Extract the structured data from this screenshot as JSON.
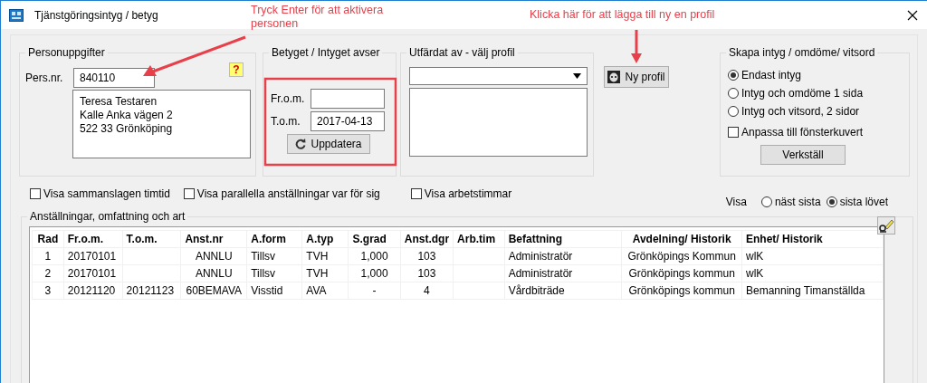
{
  "window": {
    "title": "Tjänstgöringsintyg / betyg"
  },
  "annotations": [
    {
      "text": "Tryck Enter för att aktivera personen"
    },
    {
      "text": "Klicka här för att lägga till ny en profil"
    }
  ],
  "person": {
    "title": "Personuppgifter",
    "pers_nr_label": "Pers.nr.",
    "pers_nr_value": "840110",
    "help_button": "?",
    "address_lines": [
      "Teresa Testaren",
      "Kalle Anka vägen 2",
      "522 33 Grönköping"
    ]
  },
  "period": {
    "title": "Betyget / Intyget avser",
    "from_label": "Fr.o.m.",
    "to_label": "T.o.m.",
    "to_value": "2017-04-13",
    "update_button": "Uppdatera"
  },
  "issued_by": {
    "title": "Utfärdat av - välj profil"
  },
  "new_profile_button": "Ny profil",
  "create": {
    "title": "Skapa intyg / omdöme/ vitsord",
    "options": [
      {
        "label": "Endast intyg",
        "selected": true
      },
      {
        "label": "Intyg och omdöme 1 sida",
        "selected": false
      },
      {
        "label": "Intyg och vitsord, 2 sidor",
        "selected": false
      }
    ],
    "fit_envelope": {
      "label": "Anpassa till fönsterkuvert",
      "checked": false
    },
    "apply_button": "Verkställ"
  },
  "checkboxes": [
    {
      "label": "Visa sammanslagen timtid",
      "checked": false
    },
    {
      "label": "Visa parallella anställningar var för sig",
      "checked": false
    },
    {
      "label": "Visa arbetstimmar",
      "checked": false
    }
  ],
  "show": {
    "label": "Visa",
    "options": [
      {
        "label": "näst sista",
        "selected": false
      },
      {
        "label": "sista lövet",
        "selected": true
      }
    ]
  },
  "employments": {
    "title": "Anställningar, omfattning och art",
    "columns": [
      "Rad",
      "Fr.o.m.",
      "T.o.m.",
      "Anst.nr",
      "A.form",
      "A.typ",
      "S.grad",
      "Anst.dgr",
      "Arb.tim",
      "Befattning",
      "Avdelning/ Historik",
      "Enhet/ Historik"
    ],
    "rows": [
      [
        "1",
        "20170101",
        "",
        "ANNLU",
        "Tillsv",
        "TVH",
        "1,000",
        "103",
        "",
        "Administratör",
        "Grönköpings Kommun",
        "wlK"
      ],
      [
        "2",
        "20170101",
        "",
        "ANNLU",
        "Tillsv",
        "TVH",
        "1,000",
        "103",
        "",
        "Administratör",
        "Grönköpings kommun",
        "wlK"
      ],
      [
        "3",
        "20121120",
        "20121123",
        "60BEMAVA",
        "Visstid",
        "AVA",
        "-",
        "4",
        "",
        "Vårdbiträde",
        "Grönköpings kommun",
        "Bemanning Timanställda"
      ]
    ]
  }
}
